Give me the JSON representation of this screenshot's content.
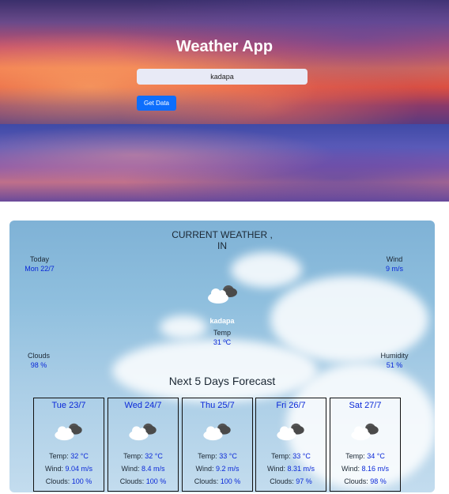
{
  "header": {
    "title": "Weather App",
    "search_value": "kadapa",
    "button_label": "Get Data"
  },
  "current": {
    "heading_line1": "CURRENT WEATHER ,",
    "heading_line2": "IN",
    "today_label": "Today",
    "today_value": "Mon 22/7",
    "wind_label": "Wind",
    "wind_value": "9 m/s",
    "icon": "cloud-sun-icon",
    "city": "kadapa",
    "temp_label": "Temp",
    "temp_value": "31 ºC",
    "clouds_label": "Clouds",
    "clouds_value": "98 %",
    "humidity_label": "Humidity",
    "humidity_value": "51 %"
  },
  "forecast": {
    "title": "Next 5 Days Forecast",
    "temp_label": "Temp:",
    "wind_label": "Wind:",
    "clouds_label": "Clouds:",
    "days": [
      {
        "day": "Tue 23/7",
        "temp": "32 °C",
        "wind": "9.04 m/s",
        "clouds": "100 %"
      },
      {
        "day": "Wed 24/7",
        "temp": "32 °C",
        "wind": "8.4 m/s",
        "clouds": "100 %"
      },
      {
        "day": "Thu 25/7",
        "temp": "33 °C",
        "wind": "9.2 m/s",
        "clouds": "100 %"
      },
      {
        "day": "Fri 26/7",
        "temp": "33 °C",
        "wind": "8.31 m/s",
        "clouds": "97 %"
      },
      {
        "day": "Sat 27/7",
        "temp": "34 °C",
        "wind": "8.16 m/s",
        "clouds": "98 %"
      }
    ]
  },
  "colors": {
    "accent": "#0d6efd",
    "value_text": "#0a28d8"
  }
}
